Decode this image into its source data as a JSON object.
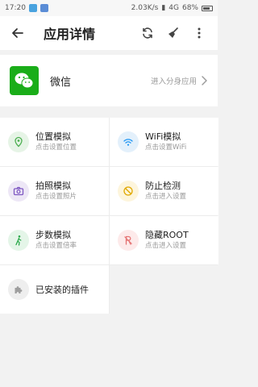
{
  "status_bar": {
    "time": "17:20",
    "speed": "2.03K/s",
    "network": "4G",
    "battery": "68%"
  },
  "header": {
    "title": "应用详情"
  },
  "app": {
    "name": "微信",
    "action_label": "进入分身应用"
  },
  "features": [
    {
      "title": "位置模拟",
      "subtitle": "点击设置位置",
      "icon": "location-icon",
      "color": "#4caf50",
      "bg": "#e6f4e6"
    },
    {
      "title": "WiFi模拟",
      "subtitle": "点击设置WiFi",
      "icon": "wifi-icon",
      "color": "#2196f3",
      "bg": "#e3f0fb"
    },
    {
      "title": "拍照模拟",
      "subtitle": "点击设置照片",
      "icon": "camera-icon",
      "color": "#7e57c2",
      "bg": "#ede7f6"
    },
    {
      "title": "防止检测",
      "subtitle": "点击进入设置",
      "icon": "block-icon",
      "color": "#e0a800",
      "bg": "#fdf5dc"
    },
    {
      "title": "步数模拟",
      "subtitle": "点击设置倍率",
      "icon": "walk-icon",
      "color": "#2aa84a",
      "bg": "#e4f5e8"
    },
    {
      "title": "隐藏ROOT",
      "subtitle": "点击进入设置",
      "icon": "hide-root-icon",
      "color": "#e57373",
      "bg": "#fdeaea"
    },
    {
      "title": "已安装的插件",
      "subtitle": "",
      "icon": "plugin-icon",
      "color": "#9e9e9e",
      "bg": "#eeeeee"
    }
  ]
}
